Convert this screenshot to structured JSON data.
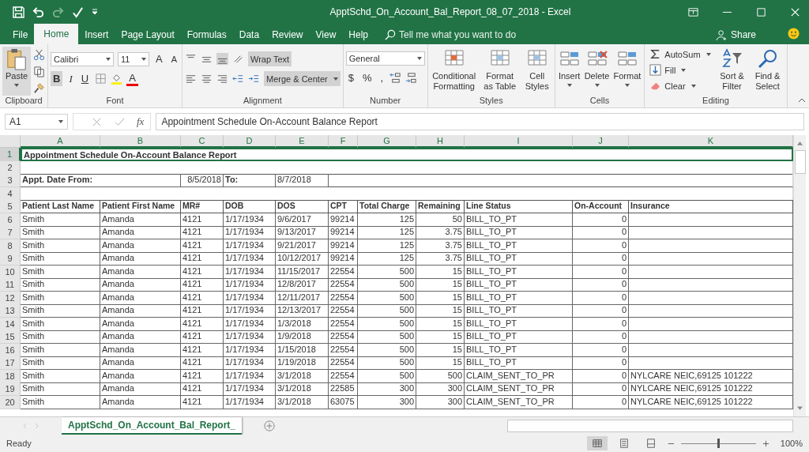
{
  "window": {
    "title": "ApptSchd_On_Account_Bal_Report_08_07_2018  -  Excel"
  },
  "tabs": [
    {
      "label": "File",
      "selected": false
    },
    {
      "label": "Home",
      "selected": true
    },
    {
      "label": "Insert",
      "selected": false
    },
    {
      "label": "Page Layout",
      "selected": false
    },
    {
      "label": "Formulas",
      "selected": false
    },
    {
      "label": "Data",
      "selected": false
    },
    {
      "label": "Review",
      "selected": false
    },
    {
      "label": "View",
      "selected": false
    },
    {
      "label": "Help",
      "selected": false
    }
  ],
  "tell_me": "Tell me what you want to do",
  "share": "Share",
  "ribbon": {
    "clipboard": {
      "label": "Clipboard",
      "paste": "Paste"
    },
    "font": {
      "label": "Font",
      "name": "Calibri",
      "size": "11",
      "grow": "A",
      "shrink": "A",
      "bold": "B",
      "italic": "I",
      "underline": "U",
      "swatch_letter": "A"
    },
    "alignment": {
      "label": "Alignment",
      "wrap": "Wrap Text",
      "merge": "Merge & Center"
    },
    "number": {
      "label": "Number",
      "format": "General",
      "symbols": [
        "$",
        "%",
        ","
      ]
    },
    "styles": {
      "label": "Styles",
      "buttons": [
        "Conditional Formatting",
        "Format as Table",
        "Cell Styles"
      ]
    },
    "cells": {
      "label": "Cells",
      "buttons": [
        "Insert",
        "Delete",
        "Format"
      ]
    },
    "editing": {
      "label": "Editing",
      "small": [
        "AutoSum",
        "Fill",
        "Clear"
      ],
      "big": [
        "Sort & Filter",
        "Find & Select"
      ]
    }
  },
  "formula_bar": {
    "name_box": "A1",
    "fx": "fx",
    "value": "Appointment Schedule On-Account Balance Report"
  },
  "sheet": {
    "columns": [
      "A",
      "B",
      "C",
      "D",
      "E",
      "F",
      "G",
      "H",
      "I",
      "J",
      "K"
    ],
    "rows": [
      {
        "number": "1",
        "kind": "title",
        "selected": true,
        "text": "Appointment Schedule On-Account Balance Report"
      },
      {
        "number": "2",
        "kind": "blank",
        "selected": false
      },
      {
        "number": "3",
        "kind": "dates",
        "selected": false,
        "from_label": "Appt. Date From:",
        "from_value": "8/5/2018",
        "to_label": "To:",
        "to_value": "8/7/2018"
      },
      {
        "number": "4",
        "kind": "blank",
        "selected": false
      },
      {
        "number": "5",
        "kind": "header",
        "selected": false,
        "cells": [
          "Patient Last Name",
          "Patient First Name",
          "MR#",
          "DOB",
          "DOS",
          "CPT",
          "Total Charge",
          "Remaining",
          "Line Status",
          "On-Account",
          "Insurance"
        ]
      },
      {
        "number": "6",
        "kind": "data",
        "selected": false,
        "cells": [
          "Smith",
          "Amanda",
          "4121",
          "1/17/1934",
          "9/6/2017",
          "99214",
          "125",
          "50",
          "BILL_TO_PT",
          "0"
        ]
      },
      {
        "number": "7",
        "kind": "data",
        "selected": false,
        "cells": [
          "Smith",
          "Amanda",
          "4121",
          "1/17/1934",
          "9/13/2017",
          "99214",
          "125",
          "3.75",
          "BILL_TO_PT",
          "0"
        ]
      },
      {
        "number": "8",
        "kind": "data",
        "selected": false,
        "cells": [
          "Smith",
          "Amanda",
          "4121",
          "1/17/1934",
          "9/21/2017",
          "99214",
          "125",
          "3.75",
          "BILL_TO_PT",
          "0"
        ]
      },
      {
        "number": "9",
        "kind": "data",
        "selected": false,
        "cells": [
          "Smith",
          "Amanda",
          "4121",
          "1/17/1934",
          "10/12/2017",
          "99214",
          "125",
          "3.75",
          "BILL_TO_PT",
          "0"
        ]
      },
      {
        "number": "10",
        "kind": "data",
        "selected": false,
        "cells": [
          "Smith",
          "Amanda",
          "4121",
          "1/17/1934",
          "11/15/2017",
          "22554",
          "500",
          "15",
          "BILL_TO_PT",
          "0"
        ]
      },
      {
        "number": "11",
        "kind": "data",
        "selected": false,
        "cells": [
          "Smith",
          "Amanda",
          "4121",
          "1/17/1934",
          "12/8/2017",
          "22554",
          "500",
          "15",
          "BILL_TO_PT",
          "0"
        ]
      },
      {
        "number": "12",
        "kind": "data",
        "selected": false,
        "cells": [
          "Smith",
          "Amanda",
          "4121",
          "1/17/1934",
          "12/11/2017",
          "22554",
          "500",
          "15",
          "BILL_TO_PT",
          "0"
        ]
      },
      {
        "number": "13",
        "kind": "data",
        "selected": false,
        "cells": [
          "Smith",
          "Amanda",
          "4121",
          "1/17/1934",
          "12/13/2017",
          "22554",
          "500",
          "15",
          "BILL_TO_PT",
          "0"
        ]
      },
      {
        "number": "14",
        "kind": "data",
        "selected": false,
        "cells": [
          "Smith",
          "Amanda",
          "4121",
          "1/17/1934",
          "1/3/2018",
          "22554",
          "500",
          "15",
          "BILL_TO_PT",
          "0"
        ]
      },
      {
        "number": "15",
        "kind": "data",
        "selected": false,
        "cells": [
          "Smith",
          "Amanda",
          "4121",
          "1/17/1934",
          "1/9/2018",
          "22554",
          "500",
          "15",
          "BILL_TO_PT",
          "0"
        ]
      },
      {
        "number": "16",
        "kind": "data",
        "selected": false,
        "cells": [
          "Smith",
          "Amanda",
          "4121",
          "1/17/1934",
          "1/15/2018",
          "22554",
          "500",
          "15",
          "BILL_TO_PT",
          "0"
        ]
      },
      {
        "number": "17",
        "kind": "data",
        "selected": false,
        "cells": [
          "Smith",
          "Amanda",
          "4121",
          "1/17/1934",
          "1/19/2018",
          "22554",
          "500",
          "15",
          "BILL_TO_PT",
          "0"
        ]
      },
      {
        "number": "18",
        "kind": "data",
        "selected": false,
        "cells": [
          "Smith",
          "Amanda",
          "4121",
          "1/17/1934",
          "3/1/2018",
          "22554",
          "500",
          "500",
          "CLAIM_SENT_TO_PR",
          "0",
          "NYLCARE NEIC,69125 101222"
        ]
      },
      {
        "number": "19",
        "kind": "data",
        "selected": false,
        "cells": [
          "Smith",
          "Amanda",
          "4121",
          "1/17/1934",
          "3/1/2018",
          "22585",
          "300",
          "300",
          "CLAIM_SENT_TO_PR",
          "0",
          "NYLCARE NEIC,69125 101222"
        ]
      },
      {
        "number": "20",
        "kind": "data",
        "selected": false,
        "cells": [
          "Smith",
          "Amanda",
          "4121",
          "1/17/1934",
          "3/1/2018",
          "63075",
          "300",
          "300",
          "CLAIM_SENT_TO_PR",
          "0",
          "NYLCARE NEIC,69125 101222"
        ]
      }
    ]
  },
  "sheet_tabs": [
    {
      "label": "ApptSchd_On_Account_Bal_Report_",
      "selected": true
    }
  ],
  "status_bar": {
    "status": "Ready",
    "zoom": "100%",
    "zoom_slider": {
      "level": 0.5
    }
  }
}
